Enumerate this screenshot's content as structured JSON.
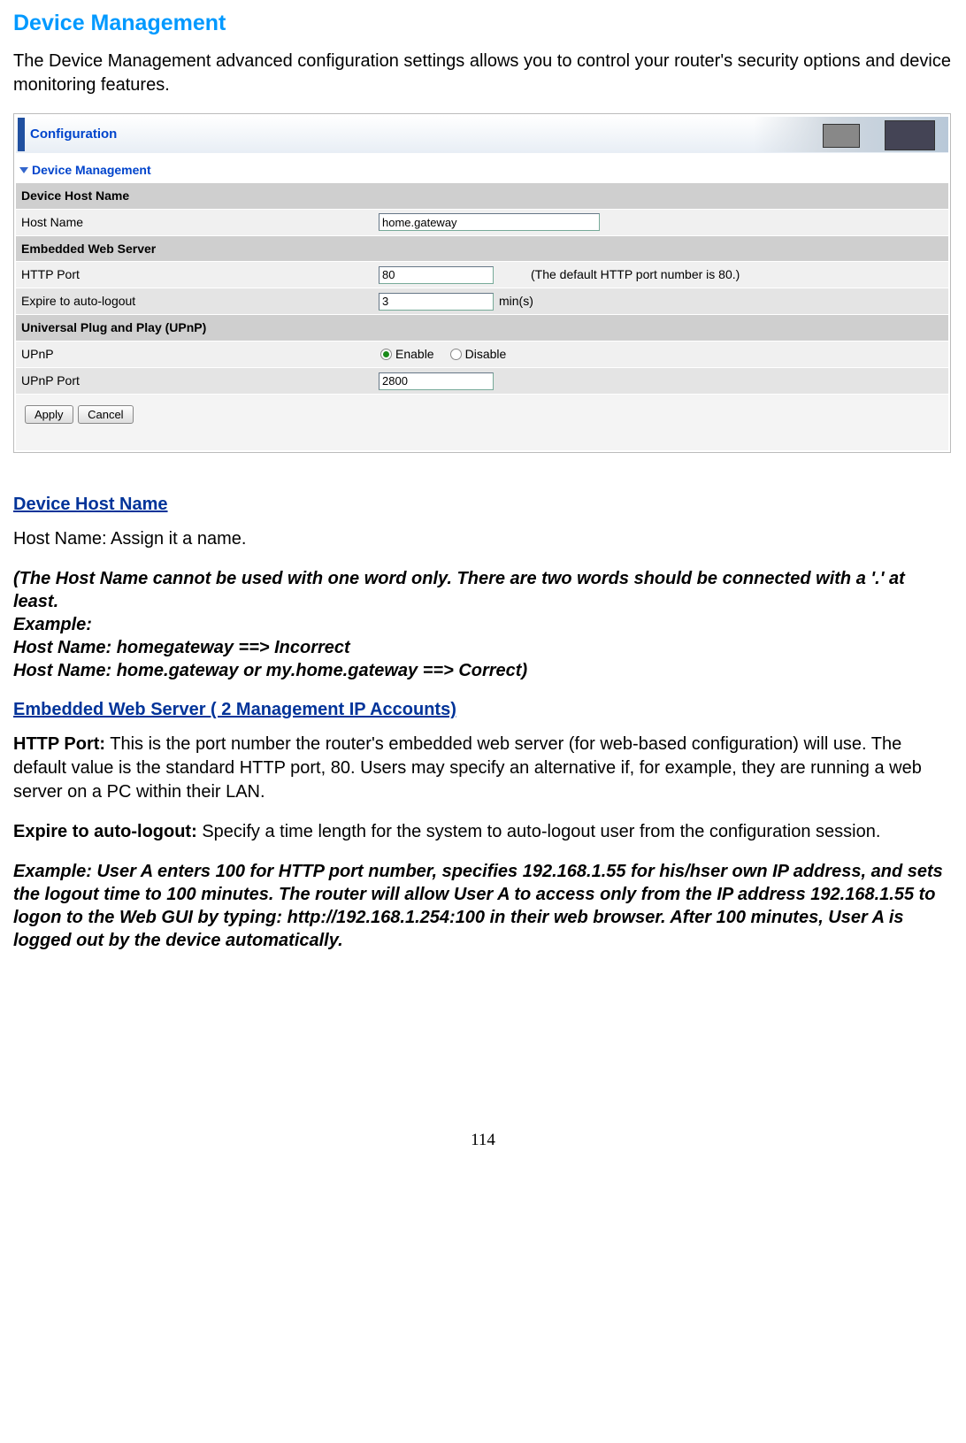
{
  "page": {
    "title": "Device Management",
    "intro": "The Device Management advanced configuration settings allows you to control your router's security options and device monitoring features.",
    "page_number": "114"
  },
  "screenshot": {
    "config_label": "Configuration",
    "section_title": "Device Management",
    "groups": {
      "host": {
        "header": "Device Host Name",
        "host_name_label": "Host Name",
        "host_name_value": "home.gateway"
      },
      "webserver": {
        "header": "Embedded Web Server",
        "http_port_label": "HTTP Port",
        "http_port_value": "80",
        "http_port_hint": "(The default HTTP port number is 80.)",
        "expire_label": "Expire to auto-logout",
        "expire_value": "3",
        "expire_unit": "min(s)"
      },
      "upnp": {
        "header": "Universal Plug and Play (UPnP)",
        "upnp_label": "UPnP",
        "enable_label": "Enable",
        "disable_label": "Disable",
        "port_label": "UPnP Port",
        "port_value": "2800"
      }
    },
    "buttons": {
      "apply": "Apply",
      "cancel": "Cancel"
    }
  },
  "sections": {
    "host_name": {
      "heading": "Device Host Name",
      "text": "Host Name: Assign it a name.",
      "note_line1": "(The Host Name cannot be used with one word only. There are two words should be connected with a '.' at least.",
      "note_line2": "Example:",
      "note_line3": "Host Name: homegateway ==> Incorrect",
      "note_line4": "Host Name: home.gateway or my.home.gateway ==> Correct)"
    },
    "webserver": {
      "heading": "Embedded Web Server ( 2 Management IP Accounts)",
      "http_port_bold": "HTTP Port:",
      "http_port_text": " This is the port number the router's embedded web server (for web-based configuration) will use. The default value is the standard HTTP port, 80. Users may specify an alternative if, for example, they are running a web server on a PC within their LAN.",
      "expire_bold": "Expire to auto-logout:",
      "expire_text": " Specify a time length for the system to auto-logout user from the configuration session.",
      "example": "Example: User A enters 100 for HTTP port number, specifies 192.168.1.55 for his/hser own IP address, and sets the logout time to 100 minutes. The router will allow User A to access only from the IP address 192.168.1.55 to logon to the Web GUI by typing: http://192.168.1.254:100 in their web browser. After 100 minutes, User A is logged out by the device automatically."
    }
  }
}
